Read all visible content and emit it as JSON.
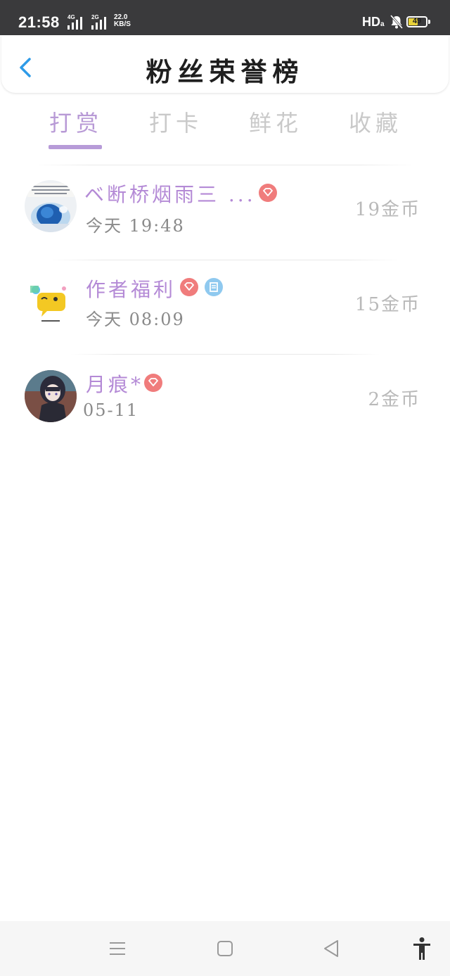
{
  "status_bar": {
    "time": "21:58",
    "signal1_label": "4G",
    "signal2_label": "2G",
    "net_speed_value": "22.0",
    "net_speed_unit": "KB/S",
    "hd_label": "HD",
    "battery": "49"
  },
  "header": {
    "title": "粉丝荣誉榜"
  },
  "tabs": [
    {
      "label": "打赏",
      "active": true
    },
    {
      "label": "打卡",
      "active": false
    },
    {
      "label": "鲜花",
      "active": false
    },
    {
      "label": "收藏",
      "active": false
    }
  ],
  "fans": [
    {
      "name": "ベ断桥烟雨三 ...",
      "time": "今天 19:48",
      "amount": "19金币",
      "badges": [
        "diamond"
      ]
    },
    {
      "name": "作者福利",
      "time": "今天 08:09",
      "amount": "15金币",
      "badges": [
        "diamond",
        "official"
      ]
    },
    {
      "name": "月痕*",
      "time": "05-11",
      "amount": "2金币",
      "badges": [
        "diamond"
      ]
    }
  ],
  "colors": {
    "accent": "#b79bd8",
    "name": "#b48ad6",
    "badge_red": "#f07c7c",
    "badge_blue": "#8fc9ef"
  }
}
